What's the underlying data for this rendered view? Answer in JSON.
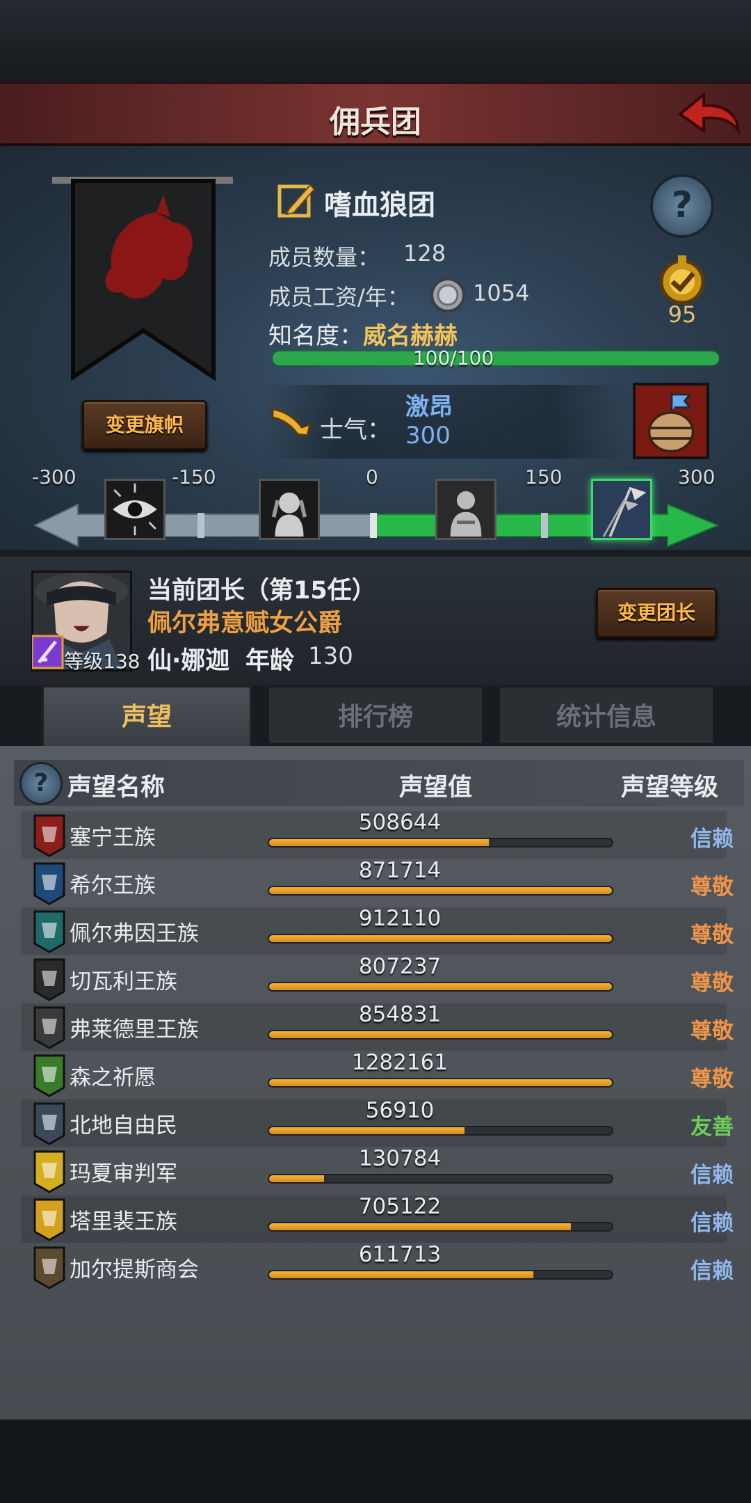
{
  "header": {
    "title": "佣兵团",
    "back_icon": "back-arrow-icon"
  },
  "guild": {
    "name": "嗜血狼团",
    "members_label": "成员数量：",
    "members_value": "128",
    "salary_label": "成员工资/年：",
    "salary_value": "1054",
    "fame_label": "知名度：",
    "fame_value": "威名赫赫",
    "fame_progress": "100/100",
    "fame_fraction": 1.0,
    "rank_value": "95",
    "change_flag_label": "变更旗帜"
  },
  "morale": {
    "label": "士气：",
    "state": "激昂",
    "value": "300",
    "scale_labels": [
      "-300",
      "-150",
      "0",
      "150",
      "300"
    ],
    "scale_min": -300,
    "scale_max": 300,
    "icons": [
      "eye-icon",
      "despair-icon",
      "calm-icon",
      "victory-flag-icon"
    ]
  },
  "leader": {
    "title": "当前团长（第15任）",
    "noble_title": "佩尔弗意赋女公爵",
    "name": "仙·娜迦",
    "age_label": "年龄",
    "age_value": "130",
    "level_label": "等级",
    "level_value": "138",
    "change_leader_label": "变更团长"
  },
  "tabs": [
    {
      "label": "声望",
      "active": true
    },
    {
      "label": "排行榜",
      "active": false
    },
    {
      "label": "统计信息",
      "active": false
    }
  ],
  "table": {
    "col_name": "声望名称",
    "col_value": "声望值",
    "col_level": "声望等级",
    "rows": [
      {
        "name": "塞宁王族",
        "value": "508644",
        "fill": 0.64,
        "level": "信赖",
        "level_color": "#8fb8ee",
        "crest_color": "#8b1e1a"
      },
      {
        "name": "希尔王族",
        "value": "871714",
        "fill": 1.0,
        "level": "尊敬",
        "level_color": "#f0954a",
        "crest_color": "#1f4a78"
      },
      {
        "name": "佩尔弗因王族",
        "value": "912110",
        "fill": 1.0,
        "level": "尊敬",
        "level_color": "#f0954a",
        "crest_color": "#1e6a68"
      },
      {
        "name": "切瓦利王族",
        "value": "807237",
        "fill": 1.0,
        "level": "尊敬",
        "level_color": "#f0954a",
        "crest_color": "#2a2a2a"
      },
      {
        "name": "弗莱德里王族",
        "value": "854831",
        "fill": 1.0,
        "level": "尊敬",
        "level_color": "#f0954a",
        "crest_color": "#3a3a3a"
      },
      {
        "name": "森之祈愿",
        "value": "1282161",
        "fill": 1.0,
        "level": "尊敬",
        "level_color": "#f0954a",
        "crest_color": "#3a7a2a"
      },
      {
        "name": "北地自由民",
        "value": "56910",
        "fill": 0.57,
        "level": "友善",
        "level_color": "#6ccf5a",
        "crest_color": "#3a4a5a"
      },
      {
        "name": "玛夏审判军",
        "value": "130784",
        "fill": 0.16,
        "level": "信赖",
        "level_color": "#8fb8ee",
        "crest_color": "#d4b020"
      },
      {
        "name": "塔里裴王族",
        "value": "705122",
        "fill": 0.88,
        "level": "信赖",
        "level_color": "#8fb8ee",
        "crest_color": "#d4a020"
      },
      {
        "name": "加尔提斯商会",
        "value": "611713",
        "fill": 0.77,
        "level": "信赖",
        "level_color": "#8fb8ee",
        "crest_color": "#5a4a30"
      }
    ]
  }
}
